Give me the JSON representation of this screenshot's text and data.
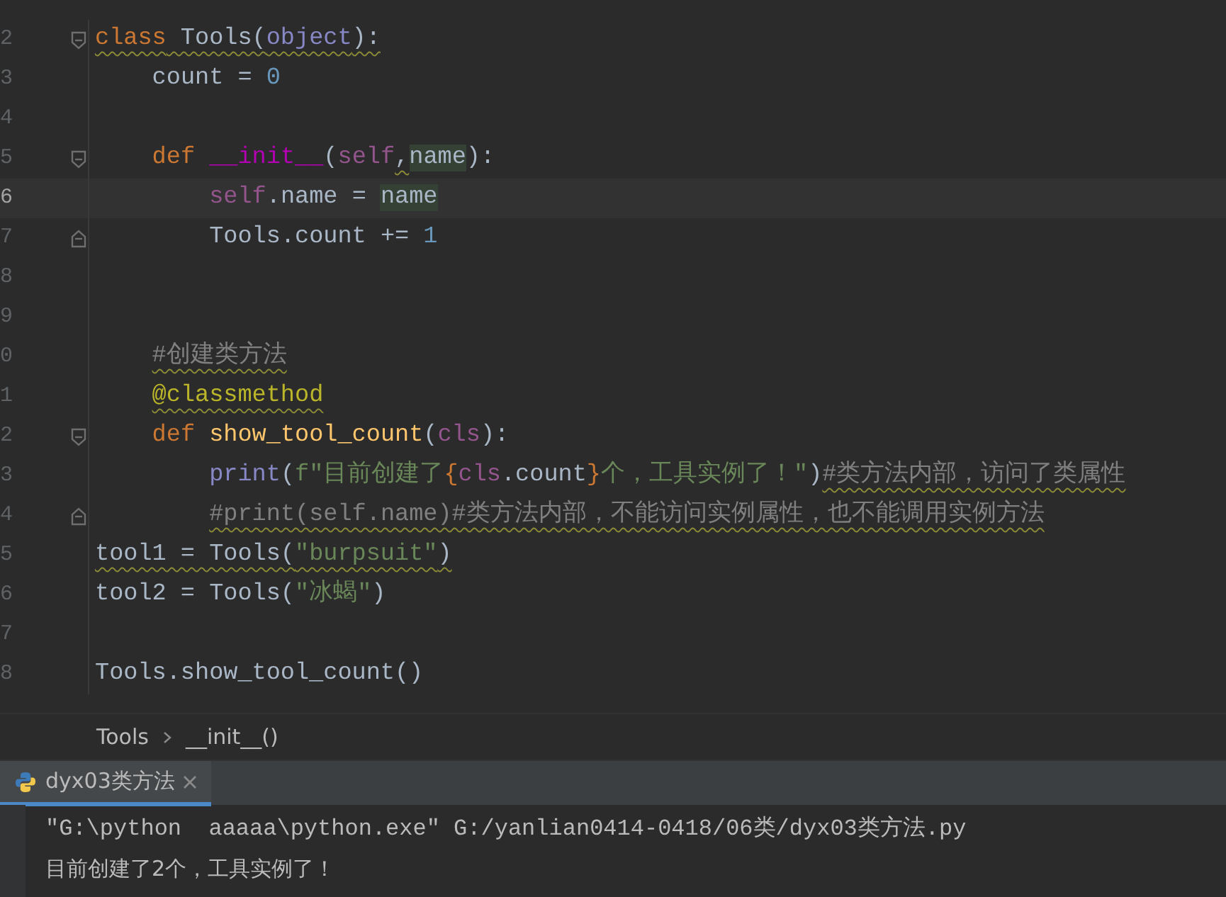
{
  "editor": {
    "lines": [
      {
        "number": "2",
        "current": false,
        "tokens": [
          {
            "text": "class",
            "kind": "keyword",
            "warning": true,
            "highlighted": false
          },
          {
            "text": " Tools(",
            "kind": "plain",
            "warning": true,
            "highlighted": false
          },
          {
            "text": "object",
            "kind": "builtin",
            "warning": true,
            "highlighted": false
          },
          {
            "text": "):",
            "kind": "plain",
            "warning": true,
            "highlighted": false
          }
        ],
        "children": [
          {
            "number": "3",
            "current": false,
            "tokens": [
              {
                "text": "count = ",
                "kind": "plain",
                "warning": false,
                "highlighted": false
              },
              {
                "text": "0",
                "kind": "number",
                "warning": false,
                "highlighted": false
              }
            ]
          },
          {
            "number": "4",
            "current": false
          },
          {
            "number": "5",
            "current": false,
            "tokens": [
              {
                "text": "def ",
                "kind": "keyword",
                "warning": false,
                "highlighted": false
              },
              {
                "text": "__init__",
                "kind": "magic",
                "warning": false,
                "highlighted": false
              },
              {
                "text": "(",
                "kind": "plain",
                "warning": false,
                "highlighted": false
              },
              {
                "text": "self",
                "kind": "self",
                "warning": false,
                "highlighted": false
              },
              {
                "text": ",",
                "kind": "plain",
                "warning": true,
                "highlighted": false
              },
              {
                "text": "name",
                "kind": "plain",
                "warning": false,
                "highlighted": true
              },
              {
                "text": "):",
                "kind": "plain",
                "warning": false,
                "highlighted": false
              }
            ],
            "children": [
              {
                "number": "6",
                "current": true,
                "tokens": [
                  {
                    "text": "self",
                    "kind": "self",
                    "warning": false,
                    "highlighted": false
                  },
                  {
                    "text": ".name = ",
                    "kind": "plain",
                    "warning": false,
                    "highlighted": false
                  },
                  {
                    "text": "name",
                    "kind": "plain",
                    "warning": false,
                    "highlighted": true
                  }
                ]
              },
              {
                "number": "7",
                "current": false,
                "tokens": [
                  {
                    "text": "Tools.count += ",
                    "kind": "plain",
                    "warning": false,
                    "highlighted": false
                  },
                  {
                    "text": "1",
                    "kind": "number",
                    "warning": false,
                    "highlighted": false
                  }
                ]
              }
            ]
          },
          {
            "number": "8",
            "current": false
          },
          {
            "number": "9",
            "current": false
          },
          {
            "number": "0",
            "current": false,
            "tokens": [
              {
                "text": "#创建类方法",
                "kind": "comment",
                "warning": true,
                "highlighted": false
              }
            ]
          },
          {
            "number": "1",
            "current": false,
            "tokens": [
              {
                "text": "@classmethod",
                "kind": "decorator",
                "warning": true,
                "highlighted": false
              }
            ]
          },
          {
            "number": "2",
            "current": false,
            "tokens": [
              {
                "text": "def ",
                "kind": "keyword",
                "warning": false,
                "highlighted": false
              },
              {
                "text": "show_tool_count",
                "kind": "function",
                "warning": false,
                "highlighted": false
              },
              {
                "text": "(",
                "kind": "plain",
                "warning": false,
                "highlighted": false
              },
              {
                "text": "cls",
                "kind": "self",
                "warning": false,
                "highlighted": false
              },
              {
                "text": "):",
                "kind": "plain",
                "warning": false,
                "highlighted": false
              }
            ],
            "children": [
              {
                "number": "3",
                "current": false,
                "tokens": [
                  {
                    "text": "print",
                    "kind": "builtin",
                    "warning": false,
                    "highlighted": false
                  },
                  {
                    "text": "(",
                    "kind": "plain",
                    "warning": false,
                    "highlighted": false
                  },
                  {
                    "text": "f\"目前创建了",
                    "kind": "string",
                    "warning": false,
                    "highlighted": false
                  },
                  {
                    "text": "{",
                    "kind": "keyword",
                    "warning": false,
                    "highlighted": false
                  },
                  {
                    "text": "cls",
                    "kind": "self",
                    "warning": false,
                    "highlighted": false
                  },
                  {
                    "text": ".count",
                    "kind": "plain",
                    "warning": false,
                    "highlighted": false
                  },
                  {
                    "text": "}",
                    "kind": "keyword",
                    "warning": false,
                    "highlighted": false
                  },
                  {
                    "text": "个，工具实例了！\"",
                    "kind": "string",
                    "warning": false,
                    "highlighted": false
                  },
                  {
                    "text": ")",
                    "kind": "plain",
                    "warning": false,
                    "highlighted": false
                  },
                  {
                    "text": "#类方法内部，访问了类属性",
                    "kind": "comment",
                    "warning": true,
                    "highlighted": false
                  }
                ]
              },
              {
                "number": "4",
                "current": false,
                "tokens": [
                  {
                    "text": "#print(self.name)#类方法内部，不能访问实例属性，也不能调用实例方法",
                    "kind": "comment",
                    "warning": true,
                    "highlighted": false
                  }
                ]
              }
            ]
          }
        ]
      },
      {
        "number": "5",
        "current": false,
        "tokens": [
          {
            "text": "tool1 = Tools(",
            "kind": "plain",
            "warning": true,
            "highlighted": false
          },
          {
            "text": "\"burpsuit\"",
            "kind": "string",
            "warning": true,
            "highlighted": false
          },
          {
            "text": ")",
            "kind": "plain",
            "warning": true,
            "highlighted": false
          }
        ]
      },
      {
        "number": "6",
        "current": false,
        "tokens": [
          {
            "text": "tool2 = Tools(",
            "kind": "plain",
            "warning": false,
            "highlighted": false
          },
          {
            "text": "\"冰蝎\"",
            "kind": "string",
            "warning": false,
            "highlighted": false
          },
          {
            "text": ")",
            "kind": "plain",
            "warning": false,
            "highlighted": false
          }
        ]
      },
      {
        "number": "7",
        "current": false
      },
      {
        "number": "8",
        "current": false,
        "tokens": [
          {
            "text": "Tools.show_tool_count()",
            "kind": "plain",
            "warning": false,
            "highlighted": false
          }
        ]
      }
    ]
  },
  "breadcrumb": [
    "Tools",
    "__init__()"
  ],
  "run_tabs": [
    {
      "label": "dyx03类方法",
      "selected": true
    }
  ],
  "console": [
    {
      "text": "\"G:\\python  aaaaa\\python.exe\" G:/yanlian0414-0418/06类/dyx03类方法.py",
      "kind": "command"
    },
    {
      "text": "目前创建了2个，工具实例了！",
      "kind": "output"
    }
  ]
}
